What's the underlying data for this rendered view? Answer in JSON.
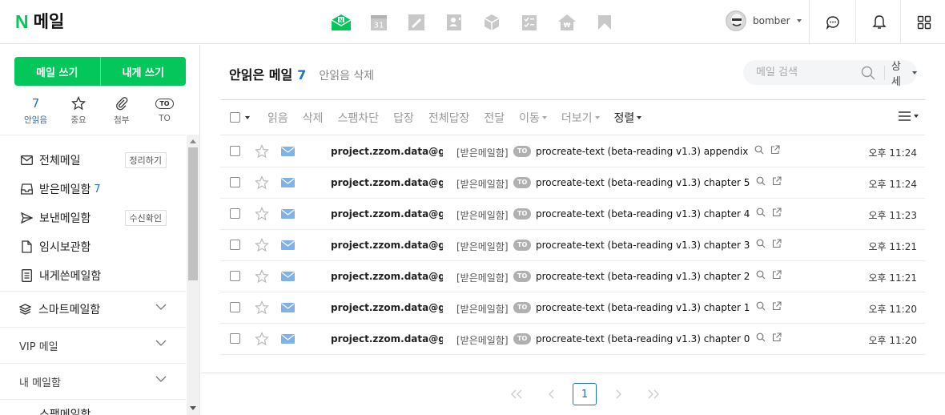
{
  "header": {
    "logo_mark": "N",
    "title": "메일",
    "apps": [
      "mail-app-icon",
      "calendar-icon",
      "memo-icon",
      "contacts-icon",
      "box-icon",
      "todo-icon",
      "home-icon",
      "bookmark-icon"
    ],
    "calendar_day": "31",
    "username": "bomber"
  },
  "sidebar": {
    "write_mail": "메일 쓰기",
    "write_self": "내게 쓰기",
    "quick": [
      {
        "count": "7",
        "label": "안읽음"
      },
      {
        "label": "중요"
      },
      {
        "label": "첨부"
      },
      {
        "icon_text": "TO",
        "label": "TO"
      }
    ],
    "folders": [
      {
        "label": "전체메일",
        "tag": "정리하기"
      },
      {
        "label": "받은메일함",
        "count": "7"
      },
      {
        "label": "보낸메일함",
        "tag": "수신확인"
      },
      {
        "label": "임시보관함"
      },
      {
        "label": "내게쓴메일함"
      }
    ],
    "smart": "스마트메일함",
    "vip": "VIP 메일",
    "my": "내 메일함",
    "partial": "스팸메일함"
  },
  "main": {
    "title": "안읽은 메일",
    "count": "7",
    "delete_unread": "안읽음 삭제",
    "search_placeholder": "메일 검색",
    "detail": "상세",
    "actions": {
      "read": "읽음",
      "delete": "삭제",
      "spam": "스팸차단",
      "reply": "답장",
      "reply_all": "전체답장",
      "forward": "전달",
      "move": "이동",
      "more": "더보기",
      "sort": "정렬"
    },
    "rows": [
      {
        "from": "project.zzom.data@gm...",
        "folder": "[받은메일함]",
        "badge": "TO",
        "subject": "procreate-text (beta-reading v1.3) appendix",
        "time": "오후 11:24"
      },
      {
        "from": "project.zzom.data@gm...",
        "folder": "[받은메일함]",
        "badge": "TO",
        "subject": "procreate-text (beta-reading v1.3) chapter 5",
        "time": "오후 11:24"
      },
      {
        "from": "project.zzom.data@gm...",
        "folder": "[받은메일함]",
        "badge": "TO",
        "subject": "procreate-text (beta-reading v1.3) chapter 4",
        "time": "오후 11:23"
      },
      {
        "from": "project.zzom.data@gm...",
        "folder": "[받은메일함]",
        "badge": "TO",
        "subject": "procreate-text (beta-reading v1.3) chapter 3",
        "time": "오후 11:21"
      },
      {
        "from": "project.zzom.data@gm...",
        "folder": "[받은메일함]",
        "badge": "TO",
        "subject": "procreate-text (beta-reading v1.3) chapter 2",
        "time": "오후 11:21"
      },
      {
        "from": "project.zzom.data@gm...",
        "folder": "[받은메일함]",
        "badge": "TO",
        "subject": "procreate-text (beta-reading v1.3) chapter 1",
        "time": "오후 11:20"
      },
      {
        "from": "project.zzom.data@gm...",
        "folder": "[받은메일함]",
        "badge": "TO",
        "subject": "procreate-text (beta-reading v1.3) chapter 0",
        "time": "오후 11:20"
      }
    ],
    "current_page": "1"
  },
  "colors": {
    "brand": "#03c75a",
    "accent": "#1a73c8",
    "envelope": "#7fb3e8"
  }
}
